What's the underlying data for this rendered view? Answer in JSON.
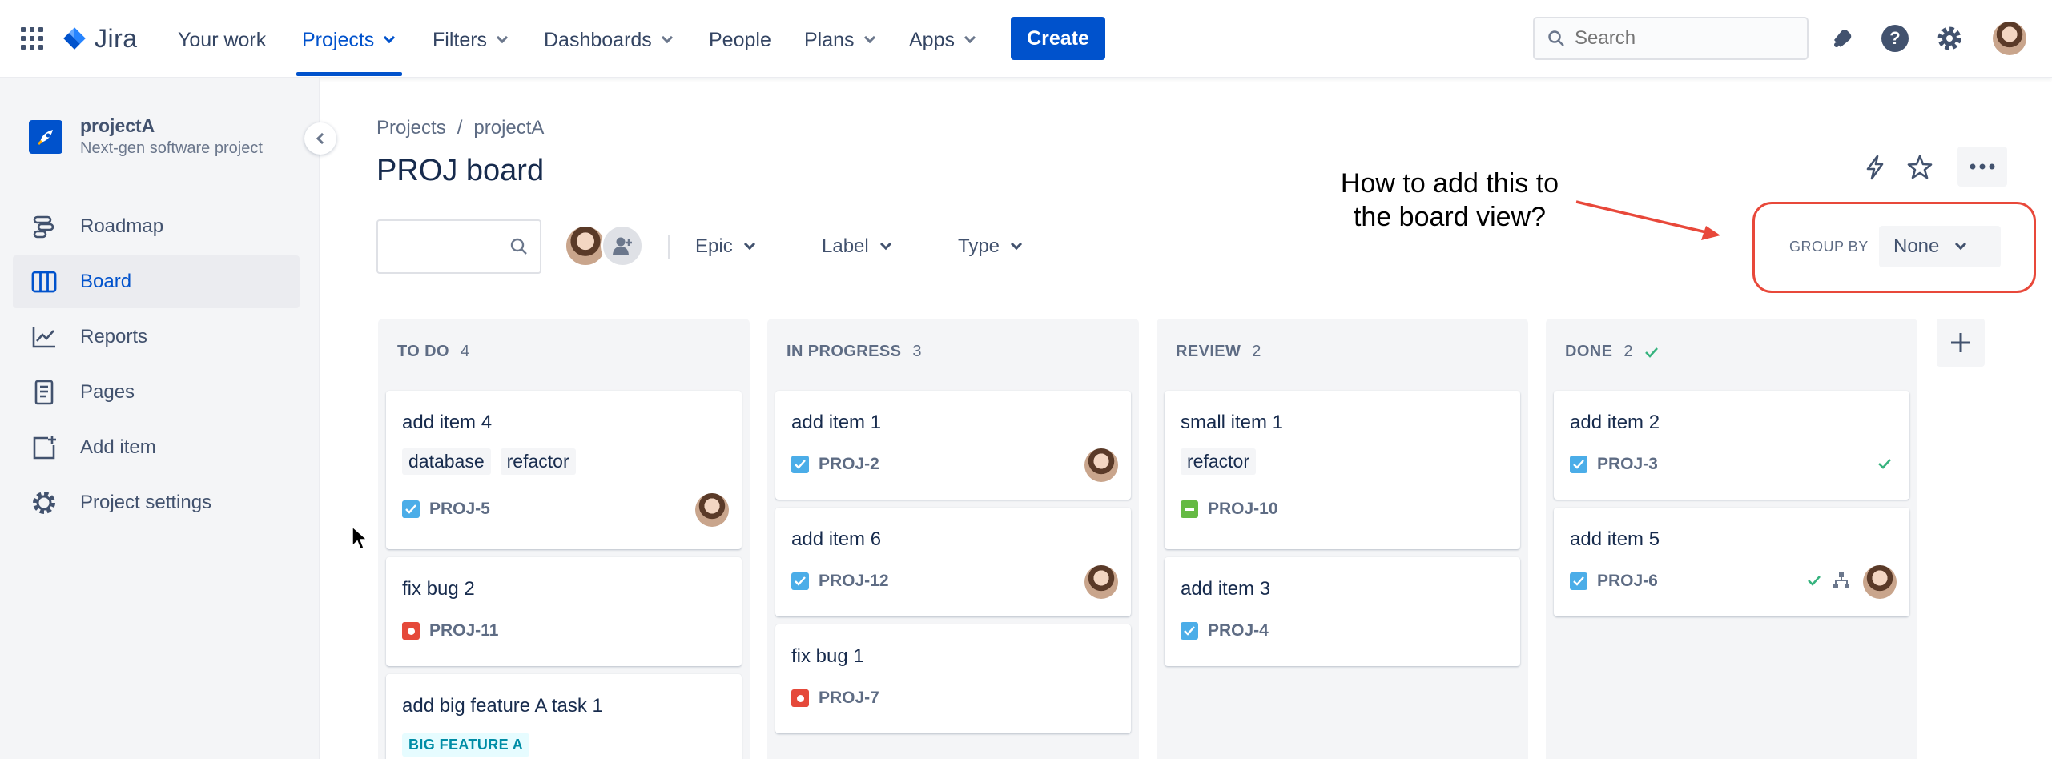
{
  "topnav": {
    "logo_text": "Jira",
    "items": [
      {
        "label": "Your work"
      },
      {
        "label": "Projects"
      },
      {
        "label": "Filters"
      },
      {
        "label": "Dashboards"
      },
      {
        "label": "People"
      },
      {
        "label": "Plans"
      },
      {
        "label": "Apps"
      }
    ],
    "create_label": "Create",
    "search_placeholder": "Search"
  },
  "sidebar": {
    "project_name": "projectA",
    "project_type": "Next-gen software project",
    "items": [
      {
        "label": "Roadmap",
        "icon": "roadmap-icon"
      },
      {
        "label": "Board",
        "icon": "board-icon"
      },
      {
        "label": "Reports",
        "icon": "reports-icon"
      },
      {
        "label": "Pages",
        "icon": "pages-icon"
      },
      {
        "label": "Add item",
        "icon": "add-item-icon"
      },
      {
        "label": "Project settings",
        "icon": "gear-icon"
      }
    ]
  },
  "breadcrumb": {
    "root": "Projects",
    "sep": "/",
    "project": "projectA"
  },
  "page_title": "PROJ board",
  "filters": {
    "epic": "Epic",
    "label": "Label",
    "type": "Type"
  },
  "group_by": {
    "label": "GROUP BY",
    "value": "None"
  },
  "annotation": {
    "line1": "How to add this to",
    "line2": "the board view?"
  },
  "colors": {
    "accent": "#0052cc",
    "annotation": "#e8483a",
    "epic_text": "#008da6"
  },
  "columns": [
    {
      "name": "TO DO",
      "count": "4",
      "cards": [
        {
          "title": "add item 4",
          "labels": [
            "database",
            "refactor"
          ],
          "key": "PROJ-5",
          "type": "story"
        },
        {
          "title": "fix bug 2",
          "key": "PROJ-11",
          "type": "bug"
        },
        {
          "title": "add big feature A task 1",
          "epic": "BIG FEATURE A"
        }
      ]
    },
    {
      "name": "IN PROGRESS",
      "count": "3",
      "cards": [
        {
          "title": "add item 1",
          "key": "PROJ-2",
          "type": "story"
        },
        {
          "title": "add item 6",
          "key": "PROJ-12",
          "type": "story"
        },
        {
          "title": "fix bug 1",
          "key": "PROJ-7",
          "type": "bug"
        }
      ]
    },
    {
      "name": "REVIEW",
      "count": "2",
      "cards": [
        {
          "title": "small item 1",
          "labels": [
            "refactor"
          ],
          "key": "PROJ-10",
          "type": "task"
        },
        {
          "title": "add item 3",
          "key": "PROJ-4",
          "type": "story"
        }
      ]
    },
    {
      "name": "DONE",
      "count": "2",
      "cards": [
        {
          "title": "add item 2",
          "key": "PROJ-3",
          "type": "story"
        },
        {
          "title": "add item 5",
          "key": "PROJ-6",
          "type": "story"
        }
      ]
    }
  ]
}
